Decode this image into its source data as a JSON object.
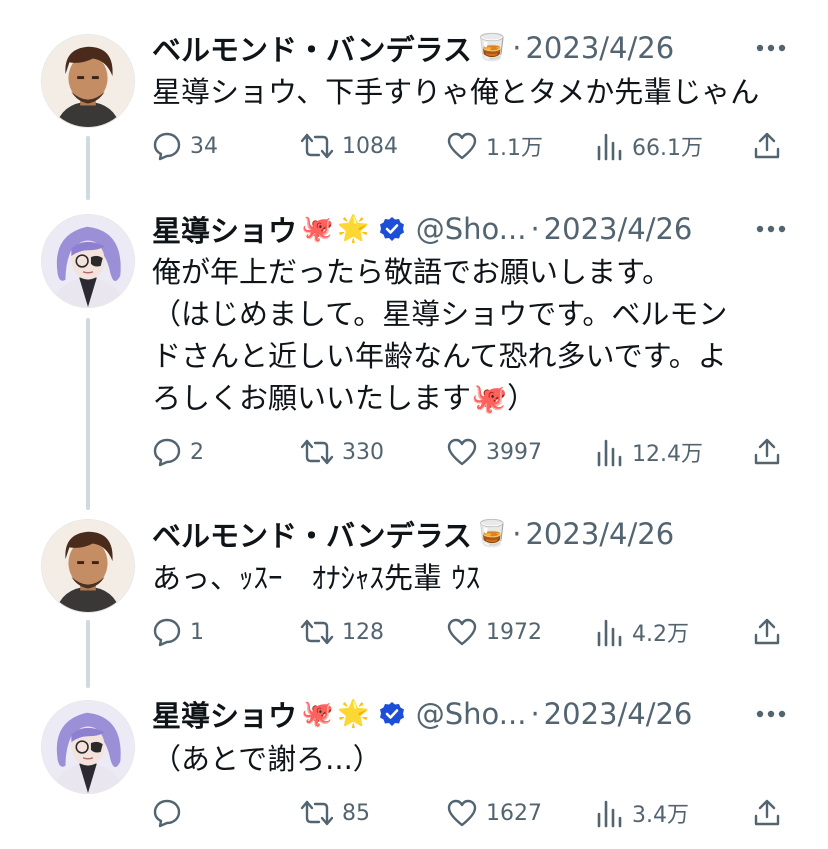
{
  "tweets": [
    {
      "name": "ベルモンド・バンデラス",
      "emoji_1": "🥃",
      "emoji_2": "",
      "handle": "",
      "verified": false,
      "sep": "·",
      "date": "2023/4/26",
      "text": "星導ショウ、下手すりゃ俺とタメか先輩じゃん",
      "replies": "34",
      "retweets": "1084",
      "likes": "1.1万",
      "views": "66.1万",
      "avatar": "brown-hair-man"
    },
    {
      "name": "星導ショウ",
      "emoji_1": "🐙",
      "emoji_2": "🌟",
      "handle": "@Sho...",
      "verified": true,
      "sep": "·",
      "date": "2023/4/26",
      "text": "俺が年上だったら敬語でお願いします。\n（はじめまして。星導ショウです。ベルモン\nドさんと近しい年齢なんて恐れ多いです。よ\nろしくお願いいたします🐙）",
      "replies": "2",
      "retweets": "330",
      "likes": "3997",
      "views": "12.4万",
      "avatar": "purple-hair-man"
    },
    {
      "name": "ベルモンド・バンデラス",
      "emoji_1": "🥃",
      "emoji_2": "",
      "handle": "",
      "verified": false,
      "sep": "·",
      "date": "2023/4/26",
      "text": "あっ、ｯｽｰ　ｵﾅｼｬｽ先輩 ｳｽ",
      "replies": "1",
      "retweets": "128",
      "likes": "1972",
      "views": "4.2万",
      "avatar": "brown-hair-man"
    },
    {
      "name": "星導ショウ",
      "emoji_1": "🐙",
      "emoji_2": "🌟",
      "handle": "@Sho...",
      "verified": true,
      "sep": "·",
      "date": "2023/4/26",
      "text": "（あとで謝ろ...）",
      "replies": "",
      "retweets": "85",
      "likes": "1627",
      "views": "3.4万",
      "avatar": "purple-hair-man"
    }
  ],
  "colors": {
    "text": "#0f1419",
    "secondary": "#536471",
    "verified": "#1d4ed8",
    "thread_line": "#cfd9de"
  },
  "icons": [
    "reply-icon",
    "retweet-icon",
    "like-icon",
    "views-icon",
    "share-icon",
    "more-icon",
    "verified-badge-icon"
  ]
}
